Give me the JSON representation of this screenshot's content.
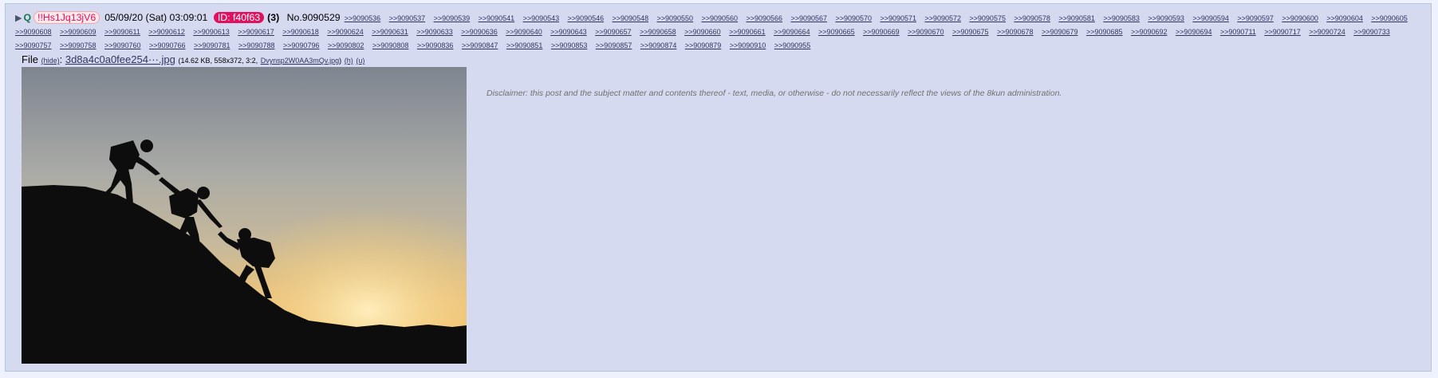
{
  "post": {
    "q_label": "Q",
    "tripcode": "!!Hs1Jq13jV6",
    "date": "05/09/20 (Sat) 03:09:01",
    "id_badge": "ID: f40f63",
    "post_count": "(3)",
    "post_number": "No.9090529",
    "backlinks": [
      ">>9090536",
      ">>9090537",
      ">>9090539",
      ">>9090541",
      ">>9090543",
      ">>9090546",
      ">>9090548",
      ">>9090550",
      ">>9090560",
      ">>9090566",
      ">>9090567",
      ">>9090570",
      ">>9090571",
      ">>9090572",
      ">>9090575",
      ">>9090578",
      ">>9090581",
      ">>9090583",
      ">>9090593",
      ">>9090594",
      ">>9090597",
      ">>9090600",
      ">>9090604",
      ">>9090605",
      ">>9090608",
      ">>9090609",
      ">>9090611",
      ">>9090612",
      ">>9090613",
      ">>9090617",
      ">>9090618",
      ">>9090624",
      ">>9090631",
      ">>9090633",
      ">>9090636",
      ">>9090640",
      ">>9090643",
      ">>9090657",
      ">>9090658",
      ">>9090660",
      ">>9090661",
      ">>9090664",
      ">>9090665",
      ">>9090669",
      ">>9090670",
      ">>9090675",
      ">>9090678",
      ">>9090679",
      ">>9090685",
      ">>9090692",
      ">>9090694",
      ">>9090711",
      ">>9090717",
      ">>9090724",
      ">>9090733",
      ">>9090757",
      ">>9090758",
      ">>9090760",
      ">>9090766",
      ">>9090781",
      ">>9090788",
      ">>9090796",
      ">>9090802",
      ">>9090808",
      ">>9090836",
      ">>9090847",
      ">>9090851",
      ">>9090853",
      ">>9090857",
      ">>9090874",
      ">>9090879",
      ">>9090910",
      ">>9090955"
    ]
  },
  "file": {
    "label": "File",
    "hide_link": "(hide)",
    "colon": ":",
    "filename": "3d8a4c0a0fee254···.jpg",
    "meta": "(14.62 KB, 558x372, 3:2,",
    "original_name": "Dvynsp2W0AA3mQv.jpg",
    "meta_close": ")",
    "h_link": "(h)",
    "u_link": "(u)"
  },
  "body": {
    "disclaimer": "Disclaimer: this post and the subject matter and contents thereof - text, media, or otherwise - do not necessarily reflect the views of the 8kun administration."
  },
  "colors": {
    "post_bg": "#d6daf0",
    "page_bg": "#eef2ff",
    "link": "#34345c",
    "id_badge": "#e0115f",
    "q_green": "#117743"
  }
}
